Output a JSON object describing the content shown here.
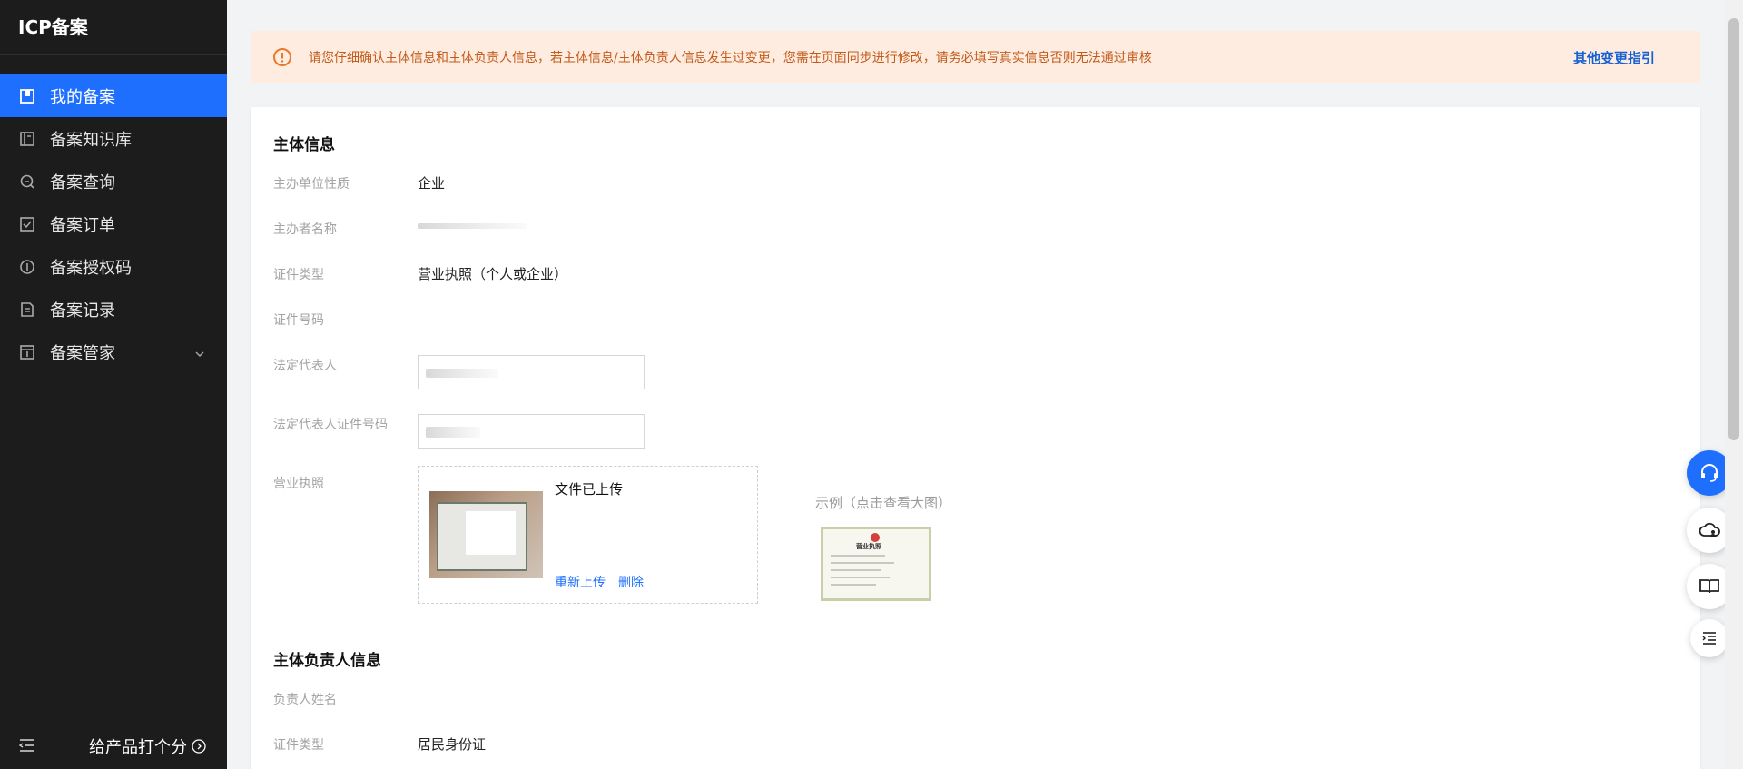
{
  "app": {
    "title": "ICP备案"
  },
  "sidebar": {
    "items": [
      {
        "label": "我的备案",
        "icon": "my-filing-icon",
        "active": true
      },
      {
        "label": "备案知识库",
        "icon": "knowledge-base-icon",
        "active": false
      },
      {
        "label": "备案查询",
        "icon": "search-icon",
        "active": false
      },
      {
        "label": "备案订单",
        "icon": "order-check-icon",
        "active": false
      },
      {
        "label": "备案授权码",
        "icon": "auth-code-icon",
        "active": false
      },
      {
        "label": "备案记录",
        "icon": "record-icon",
        "active": false
      },
      {
        "label": "备案管家",
        "icon": "butler-icon",
        "active": false
      }
    ],
    "footer_label": "给产品打个分"
  },
  "notice": {
    "text": "请您仔细确认主体信息和主体负责人信息，若主体信息/主体负责人信息发生过变更，您需在页面同步进行修改，请务必填写真实信息否则无法通过审核",
    "link": "其他变更指引"
  },
  "entity": {
    "title": "主体信息",
    "fields": [
      {
        "label": "主办单位性质",
        "value": "企业"
      },
      {
        "label": "主办者名称",
        "value": ""
      },
      {
        "label": "证件类型",
        "value": "营业执照（个人或企业）"
      },
      {
        "label": "证件号码",
        "value": ""
      },
      {
        "label": "法定代表人",
        "value": ""
      },
      {
        "label": "法定代表人证件号码",
        "value": ""
      },
      {
        "label": "营业执照",
        "value": ""
      }
    ],
    "upload": {
      "status": "文件已上传",
      "reupload": "重新上传",
      "delete": "删除"
    },
    "example_label": "示例（点击查看大图）",
    "example_title": "营业执照"
  },
  "principal": {
    "title": "主体负责人信息",
    "fields": [
      {
        "label": "负责人姓名",
        "value": ""
      },
      {
        "label": "证件类型",
        "value": "居民身份证"
      }
    ]
  },
  "colors": {
    "sidebar_bg": "#1c1c1c",
    "active": "#1f6fff",
    "notice_bg": "#fdecdf",
    "notice_text": "#c45a1a",
    "link": "#1560d4"
  },
  "fabs": [
    "headset-icon",
    "cloud-user-icon",
    "book-icon",
    "list-indent-icon"
  ]
}
